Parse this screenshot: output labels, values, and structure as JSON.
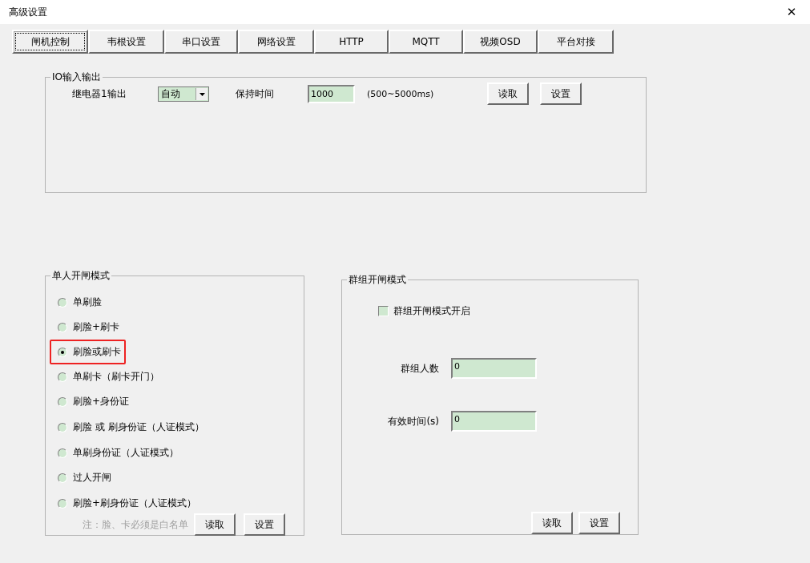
{
  "window": {
    "title": "高级设置",
    "close": "✕"
  },
  "tabs": [
    {
      "label": "闸机控制",
      "selected": true
    },
    {
      "label": "韦根设置",
      "selected": false
    },
    {
      "label": "串口设置",
      "selected": false
    },
    {
      "label": "网络设置",
      "selected": false
    },
    {
      "label": "HTTP",
      "selected": false
    },
    {
      "label": "MQTT",
      "selected": false
    },
    {
      "label": "视频OSD",
      "selected": false
    },
    {
      "label": "平台对接",
      "selected": false
    }
  ],
  "io_group": {
    "title": "IO输入输出",
    "relay_label": "继电器1输出",
    "relay_value": "自动",
    "hold_label": "保持时间",
    "hold_value": "1000",
    "hold_range": "(500~5000ms)",
    "buttons": [
      "读取",
      "设置"
    ]
  },
  "single_group": {
    "title": "单人开闸模式",
    "options": [
      {
        "label": "单刷脸",
        "selected": false,
        "highlighted": false
      },
      {
        "label": "刷脸+刷卡",
        "selected": false,
        "highlighted": false
      },
      {
        "label": "刷脸或刷卡",
        "selected": true,
        "highlighted": true
      },
      {
        "label": "单刷卡（刷卡开门）",
        "selected": false,
        "highlighted": false
      },
      {
        "label": "刷脸+身份证",
        "selected": false,
        "highlighted": false
      },
      {
        "label": "刷脸 或 刷身份证（人证模式）",
        "selected": false,
        "highlighted": false
      },
      {
        "label": "单刷身份证（人证模式）",
        "selected": false,
        "highlighted": false
      },
      {
        "label": "过人开闸",
        "selected": false,
        "highlighted": false
      },
      {
        "label": "刷脸+刷身份证（人证模式）",
        "selected": false,
        "highlighted": false
      }
    ],
    "note": "注：脸、卡必须是白名单",
    "buttons": [
      "读取",
      "设置"
    ]
  },
  "group_group": {
    "title": "群组开闸模式",
    "enable": {
      "label": "群组开闸模式开启",
      "checked": false
    },
    "fields": [
      {
        "label": "群组人数",
        "value": "0"
      },
      {
        "label": "有效时间(s)",
        "value": "0"
      }
    ],
    "buttons": [
      "读取",
      "设置"
    ]
  }
}
